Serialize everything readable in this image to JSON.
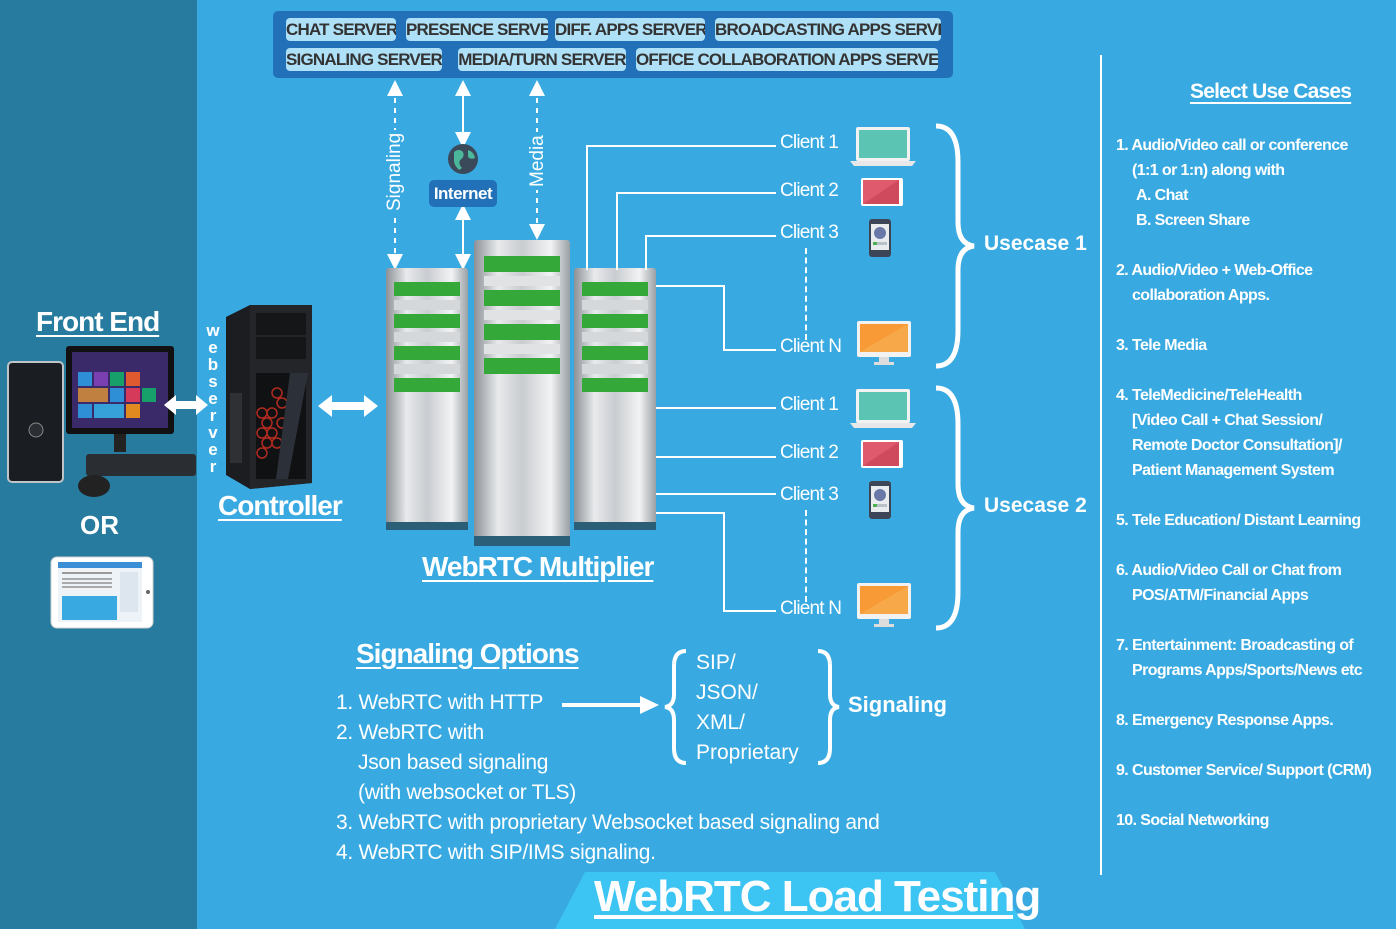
{
  "page_title": "WebRTC Load Testing",
  "colors": {
    "background": "#39aae1",
    "left_panel": "#277b9f",
    "server_box": "#2170b8",
    "server_chip": "#aee0f8",
    "banner": "#3cc4f3",
    "laptop": "#5cc4b3",
    "tablet": "#e05a6e",
    "monitor": "#f89a35"
  },
  "servers": {
    "row1": [
      "CHAT SERVER",
      "PRESENCE SERVER",
      "DIFF. APPS SERVER",
      "BROADCASTING APPS SERVER"
    ],
    "row2": [
      "SIGNALING SERVER",
      "MEDIA/TURN SERVER",
      "OFFICE COLLABORATION APPS SERVER"
    ]
  },
  "links": {
    "signaling": "Signaling",
    "internet": "Internet",
    "media": "Media"
  },
  "front_end": {
    "title": "Front End",
    "or": "OR",
    "webserver_letters": [
      "w",
      "e",
      "b",
      "s",
      "e",
      "r",
      "v",
      "e",
      "r"
    ]
  },
  "controller": {
    "title": "Controller"
  },
  "multiplier": {
    "title": "WebRTC Multiplier"
  },
  "usecase_groups": [
    {
      "label": "Usecase 1",
      "clients": [
        "Client 1",
        "Client 2",
        "Client 3",
        "Client N"
      ]
    },
    {
      "label": "Usecase 2",
      "clients": [
        "Client 1",
        "Client 2",
        "Client 3",
        "Client N"
      ]
    }
  ],
  "signaling_options": {
    "title": "Signaling Options",
    "items": [
      "1. WebRTC with HTTP",
      "2. WebRTC with",
      "    Json based signaling",
      "    (with websocket or TLS)",
      "3. WebRTC with proprietary Websocket based signaling and",
      "4. WebRTC with SIP/IMS signaling."
    ],
    "protocols": [
      "SIP/",
      "JSON/",
      "XML/",
      "Proprietary"
    ],
    "protocols_label": "Signaling"
  },
  "use_cases": {
    "title": "Select Use Cases",
    "items": [
      [
        "1. Audio/Video call or conference",
        "   (1:1 or 1:n) along with",
        "    A. Chat",
        "    B. Screen Share"
      ],
      [
        "2. Audio/Video + Web-Office",
        "   collaboration Apps."
      ],
      [
        "3. Tele Media"
      ],
      [
        "4. TeleMedicine/TeleHealth",
        "   [Video Call + Chat Session/",
        "   Remote Doctor Consultation]/",
        "   Patient Management System"
      ],
      [
        "5. Tele Education/ Distant Learning"
      ],
      [
        "6. Audio/Video Call or Chat from",
        "   POS/ATM/Financial Apps"
      ],
      [
        "7. Entertainment: Broadcasting of",
        "   Programs Apps/Sports/News etc"
      ],
      [
        "8. Emergency Response Apps."
      ],
      [
        "9. Customer Service/ Support (CRM)"
      ],
      [
        "10. Social Networking"
      ]
    ]
  },
  "banner": {
    "title": "WebRTC Load Testing"
  }
}
